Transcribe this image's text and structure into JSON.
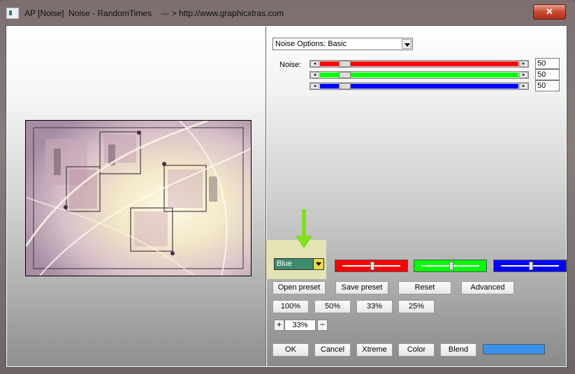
{
  "window": {
    "title": "AP [Noise]  Noise - RandomTimes    --- > http://www.graphicxtras.com",
    "close_label": "✕"
  },
  "options": {
    "dropdown_value": "Noise Options: Basic",
    "noise_label": "Noise:",
    "sliders": [
      {
        "color": "#ff0000",
        "value": "50",
        "level": 50
      },
      {
        "color": "#00ff00",
        "value": "50",
        "level": 50
      },
      {
        "color": "#0000ff",
        "value": "50",
        "level": 50
      }
    ]
  },
  "channel": {
    "select_value": "Blue",
    "select_bg": "#3d8a6f",
    "sliders": [
      {
        "color": "#ff0000",
        "level": 50
      },
      {
        "color": "#00ff00",
        "level": 50
      },
      {
        "color": "#0000ff",
        "level": 50
      }
    ]
  },
  "preset_buttons": {
    "open": "Open preset",
    "save": "Save preset",
    "reset": "Reset",
    "advanced": "Advanced"
  },
  "zoom_buttons": [
    "100%",
    "50%",
    "33%",
    "25%"
  ],
  "zoom": {
    "plus": "+",
    "value": "33%",
    "minus": "−"
  },
  "bottom_buttons": {
    "ok": "OK",
    "cancel": "Cancel",
    "xtreme": "Xtreme",
    "color": "Color",
    "blend": "Blend"
  },
  "colors": {
    "accent_arrow": "#7fe21a",
    "swatch": "#3a92ea"
  },
  "icons": {
    "app": "app-window-icon",
    "close": "close-icon",
    "annotation": "down-arrow-icon"
  }
}
